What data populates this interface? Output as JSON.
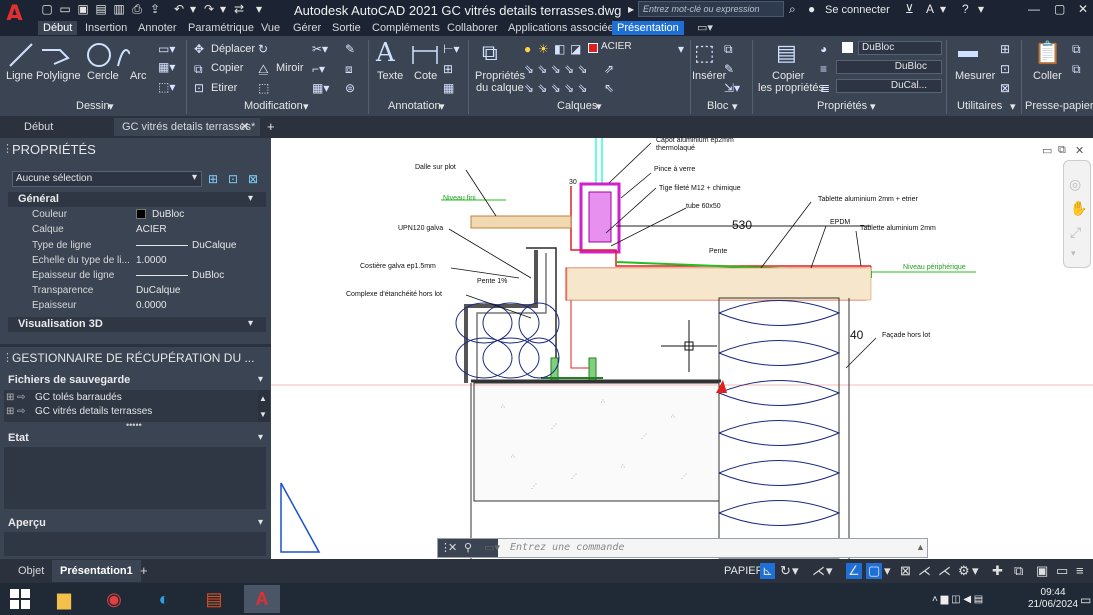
{
  "app": {
    "logo": "A",
    "title": "Autodesk AutoCAD 2021   GC vitrés details terrasses.dwg",
    "search_placeholder": "Entrez mot-clé ou expression",
    "signin": "Se connecter"
  },
  "ribbon_tabs": [
    "Début",
    "Insertion",
    "Annoter",
    "Paramétrique",
    "Vue",
    "Gérer",
    "Sortie",
    "Compléments",
    "Collaborer",
    "Applications associées",
    "Présentation"
  ],
  "ribbon": {
    "dessin": {
      "name": "Dessin",
      "tools": [
        "Ligne",
        "Polyligne",
        "Cercle",
        "Arc"
      ]
    },
    "modification": {
      "name": "Modification",
      "tools": [
        "Déplacer",
        "Copier",
        "Etirer",
        "Miroir"
      ]
    },
    "annotation": {
      "name": "Annotation",
      "tools": [
        "Texte",
        "Cote"
      ]
    },
    "calques": {
      "name": "Calques",
      "tools": [
        "Propriétés",
        "du calque"
      ],
      "current_layer": "ACIER",
      "layer_color": "#e02020"
    },
    "bloc": {
      "name": "Bloc",
      "tools": [
        "Insérer"
      ]
    },
    "proprietes": {
      "name": "Propriétés",
      "tools": [
        "Copier",
        "les propriétés"
      ],
      "color": "DuBloc",
      "linetype": "DuBloc",
      "lineweight": "DuCal..."
    },
    "utilitaires": {
      "name": "Utilitaires",
      "tools": [
        "Mesurer"
      ]
    },
    "pressepapiers": {
      "name": "Presse-papiers",
      "tools": [
        "Coller"
      ]
    }
  },
  "doc_tabs": [
    "Début",
    "GC vitrés details terrasses*"
  ],
  "properties": {
    "title": "PROPRIÉTÉS",
    "selection": "Aucune sélection",
    "general_header": "Général",
    "rows": [
      {
        "label": "Couleur",
        "value": "DuBloc"
      },
      {
        "label": "Calque",
        "value": "ACIER"
      },
      {
        "label": "Type de ligne",
        "value": "DuCalque"
      },
      {
        "label": "Echelle du type de li...",
        "value": "1.0000"
      },
      {
        "label": "Epaisseur de ligne",
        "value": "DuBloc"
      },
      {
        "label": "Transparence",
        "value": "DuCalque"
      },
      {
        "label": "Epaisseur",
        "value": "0.0000"
      }
    ],
    "vis3d_header": "Visualisation 3D"
  },
  "recovery": {
    "title": "GESTIONNAIRE DE RÉCUPÉRATION DU ...",
    "backup_header": "Fichiers de sauvegarde",
    "files": [
      "GC tolés barraudés",
      "GC vitrés details terrasses"
    ],
    "state_header": "Etat",
    "preview_header": "Aperçu"
  },
  "drawing": {
    "labels": [
      "Capot aluminium ep2mm",
      "thermolaqué",
      "Dalle sur plot",
      "Pince à verre",
      "Tige fileté M12 + chimique",
      "Niveau fini",
      "tube 60x50",
      "Tablette aluminium 2mm + etrier",
      "EPDM",
      "Tablette aluminium 2mm",
      "UPN120 galva",
      "530",
      "Pente",
      "Costière galva ep1.5mm",
      "Niveau périphérique",
      "Pente 1%",
      "Complexe d'étanchéité hors lot",
      "40",
      "Façade hors lot",
      "30"
    ]
  },
  "command": {
    "placeholder": "Entrez une commande"
  },
  "layout_tabs": [
    "Objet",
    "Présentation1"
  ],
  "status": {
    "space": "PAPIER"
  },
  "taskbar": {
    "time": "09:44",
    "date": "21/06/2024"
  }
}
